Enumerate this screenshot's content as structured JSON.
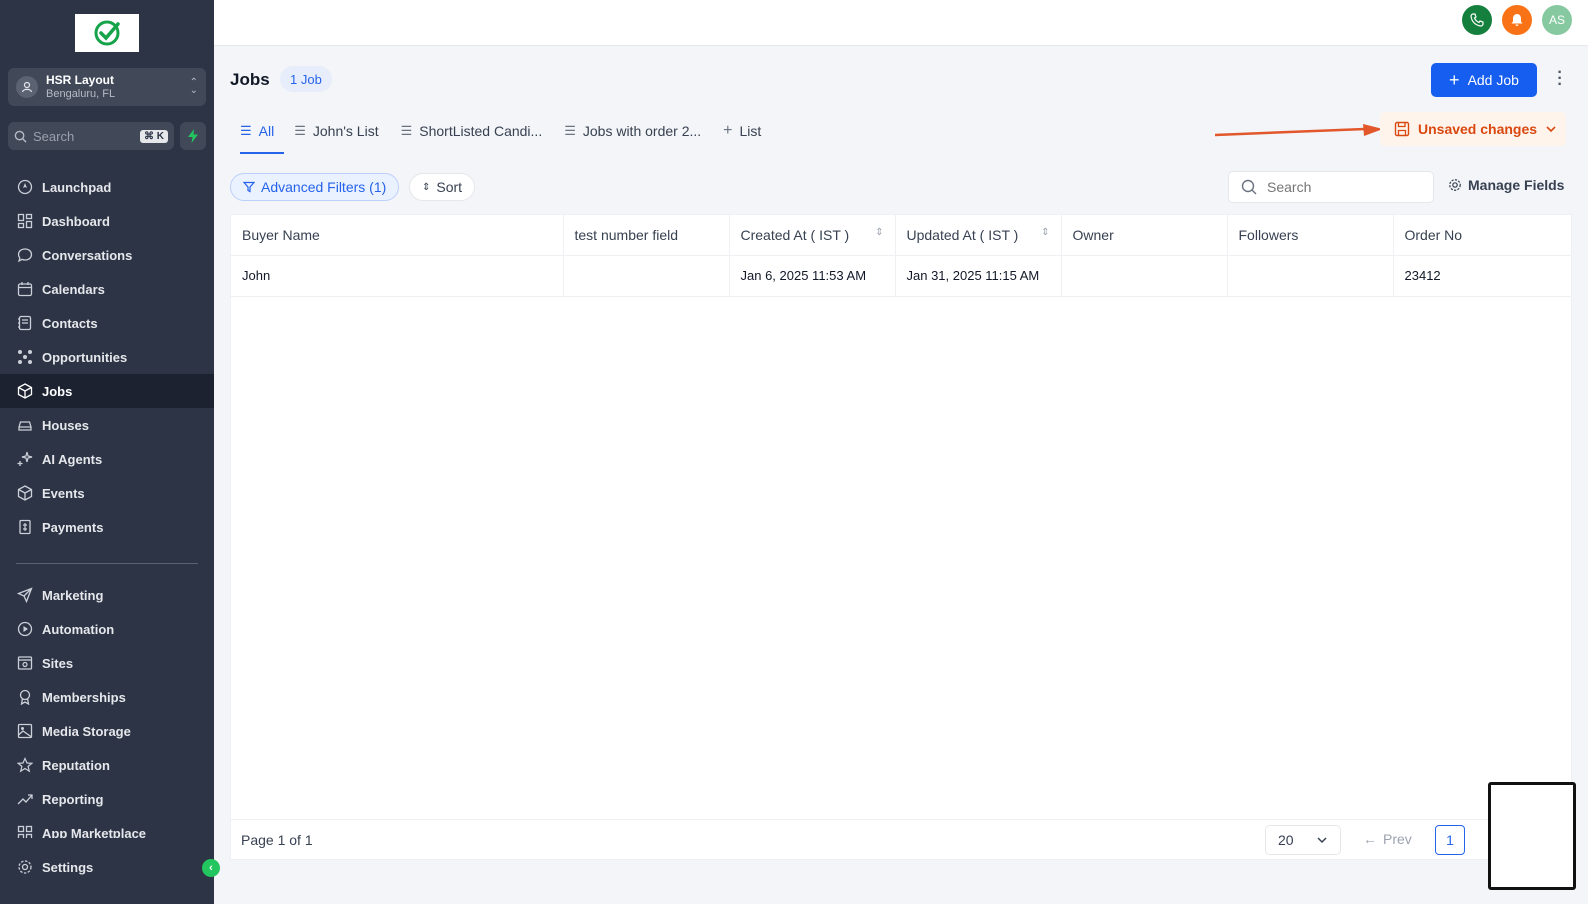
{
  "location": {
    "name": "HSR Layout",
    "sub": "Bengaluru, FL"
  },
  "sidebar_search": {
    "placeholder": "Search",
    "shortcut": "⌘ K"
  },
  "nav": [
    {
      "label": "Launchpad",
      "icon": "launchpad-icon"
    },
    {
      "label": "Dashboard",
      "icon": "dashboard-icon"
    },
    {
      "label": "Conversations",
      "icon": "chat-icon"
    },
    {
      "label": "Calendars",
      "icon": "calendar-icon"
    },
    {
      "label": "Contacts",
      "icon": "contacts-icon"
    },
    {
      "label": "Opportunities",
      "icon": "opportunities-icon"
    },
    {
      "label": "Jobs",
      "icon": "box-icon",
      "active": true
    },
    {
      "label": "Houses",
      "icon": "car-icon"
    },
    {
      "label": "AI Agents",
      "icon": "sparkle-icon"
    },
    {
      "label": "Events",
      "icon": "box-icon"
    },
    {
      "label": "Payments",
      "icon": "payments-icon"
    }
  ],
  "nav2": [
    {
      "label": "Marketing",
      "icon": "send-icon"
    },
    {
      "label": "Automation",
      "icon": "automation-icon"
    },
    {
      "label": "Sites",
      "icon": "sites-icon"
    },
    {
      "label": "Memberships",
      "icon": "award-icon"
    },
    {
      "label": "Media Storage",
      "icon": "image-icon"
    },
    {
      "label": "Reputation",
      "icon": "star-icon"
    },
    {
      "label": "Reporting",
      "icon": "trend-icon"
    },
    {
      "label": "App Marketplace",
      "icon": "grid-icon"
    }
  ],
  "settings_label": "Settings",
  "topbar": {
    "avatar_initials": "AS"
  },
  "page": {
    "title": "Jobs",
    "count": "1 Job",
    "add_button": "Add Job"
  },
  "tabs": [
    "All",
    "John's List",
    "ShortListed Candi...",
    "Jobs with order 2...",
    "List"
  ],
  "unsaved": "Unsaved changes",
  "toolbar": {
    "filter": "Advanced Filters (1)",
    "sort": "Sort",
    "search_placeholder": "Search",
    "manage_fields": "Manage Fields"
  },
  "table": {
    "columns": [
      "Buyer Name",
      "test number field",
      "Created At ( IST )",
      "Updated At ( IST )",
      "Owner",
      "Followers",
      "Order No"
    ],
    "rows": [
      [
        "John",
        "",
        "Jan 6, 2025 11:53 AM",
        "Jan 31, 2025 11:15 AM",
        "",
        "",
        "23412"
      ]
    ]
  },
  "footer": {
    "page_text": "Page 1 of 1",
    "per_page": "20",
    "prev": "Prev",
    "current_page": "1"
  },
  "colors": {
    "sidebar": "#2d3446",
    "accent": "#155eef",
    "warning": "#d9480f"
  }
}
